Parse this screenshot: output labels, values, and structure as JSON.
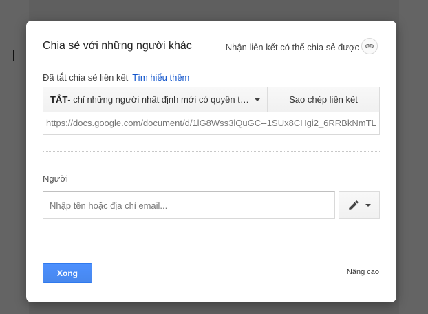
{
  "dialog": {
    "title": "Chia sẻ với những người khác",
    "get_link_label": "Nhận liên kết có thể chia sẻ được",
    "link_icon": "link-icon"
  },
  "link_sharing": {
    "status_text": "Đã tắt chia sẻ liên kết",
    "learn_more": "Tìm hiểu thêm",
    "access_strong": "TẮT",
    "access_rest": " - chỉ những người nhất định mới có quyền truy cập",
    "copy_link": "Sao chép liên kết",
    "url": "https://docs.google.com/document/d/1lG8Wss3lQuGC--1SUx8CHgi2_6RRBkNmTL"
  },
  "people": {
    "label": "Người",
    "placeholder": "Nhập tên hoặc địa chỉ email...",
    "permission_icon": "pencil-icon"
  },
  "footer": {
    "done_label": "Xong",
    "advanced_label": "Nâng cao"
  },
  "colors": {
    "primary_button": "#4d90fe",
    "link": "#1155cc",
    "overlay": "#5f5f5f"
  }
}
